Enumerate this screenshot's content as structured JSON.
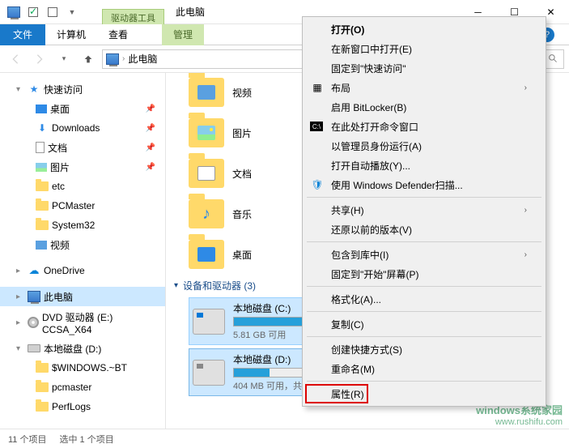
{
  "titlebar": {
    "context_tab_label": "驱动器工具",
    "window_title": "此电脑"
  },
  "ribbon": {
    "file": "文件",
    "tab_computer": "计算机",
    "tab_view": "查看",
    "tab_manage": "管理"
  },
  "address": {
    "location": "此电脑"
  },
  "sidebar": {
    "quick_access": "快速访问",
    "items": [
      {
        "label": "桌面",
        "icon": "desktop"
      },
      {
        "label": "Downloads",
        "icon": "folder"
      },
      {
        "label": "文档",
        "icon": "folder"
      },
      {
        "label": "图片",
        "icon": "folder"
      },
      {
        "label": "etc",
        "icon": "folder"
      },
      {
        "label": "PCMaster",
        "icon": "folder"
      },
      {
        "label": "System32",
        "icon": "folder"
      },
      {
        "label": "视频",
        "icon": "folder"
      }
    ],
    "onedrive": "OneDrive",
    "this_pc": "此电脑",
    "dvd": "DVD 驱动器 (E:) CCSA_X64",
    "local_disk": "本地磁盘 (D:)",
    "disk_children": [
      {
        "label": "$WINDOWS.~BT"
      },
      {
        "label": "pcmaster"
      },
      {
        "label": "PerfLogs"
      }
    ]
  },
  "content": {
    "folders": [
      {
        "label": "视频",
        "kind": "video"
      },
      {
        "label": "图片",
        "kind": "pic"
      },
      {
        "label": "文档",
        "kind": "doc"
      },
      {
        "label": "音乐",
        "kind": "mus"
      },
      {
        "label": "桌面",
        "kind": "desk"
      }
    ],
    "devices_header": "设备和驱动器 (3)",
    "drives": [
      {
        "name": "本地磁盘 (C:)",
        "free_text": "5.81 GB 可用",
        "fill_pct": 68
      },
      {
        "name": "本地磁盘 (D:)",
        "free_text": "404 MB 可用，共 598 MB",
        "fill_pct": 32
      }
    ]
  },
  "context_menu": {
    "open": "打开(O)",
    "open_new": "在新窗口中打开(E)",
    "pin_quick": "固定到\"快速访问\"",
    "layout": "布局",
    "bitlocker": "启用 BitLocker(B)",
    "cmd_here": "在此处打开命令窗口",
    "run_admin": "以管理员身份运行(A)",
    "autoplay": "打开自动播放(Y)...",
    "defender": "使用 Windows Defender扫描...",
    "share": "共享(H)",
    "prev_ver": "还原以前的版本(V)",
    "include_lib": "包含到库中(I)",
    "pin_start": "固定到\"开始\"屏幕(P)",
    "format": "格式化(A)...",
    "copy": "复制(C)",
    "shortcut": "创建快捷方式(S)",
    "rename": "重命名(M)",
    "properties": "属性(R)"
  },
  "statusbar": {
    "count": "11 个项目",
    "selected": "选中 1 个项目"
  },
  "watermark": {
    "brand": "windows系统家园",
    "url": "www.rushifu.com"
  }
}
